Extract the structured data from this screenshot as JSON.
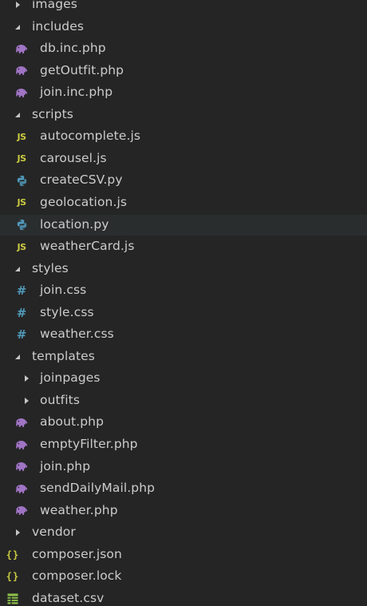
{
  "explorer": {
    "items": [
      {
        "label": "images",
        "kind": "folder",
        "state": "collapsed",
        "depth": 1,
        "icon": "chevron-right-icon"
      },
      {
        "label": "includes",
        "kind": "folder",
        "state": "expanded",
        "depth": 1,
        "icon": "chevron-down-icon"
      },
      {
        "label": "db.inc.php",
        "kind": "file",
        "depth": 2,
        "icon": "php-elephant-icon"
      },
      {
        "label": "getOutfit.php",
        "kind": "file",
        "depth": 2,
        "icon": "php-elephant-icon"
      },
      {
        "label": "join.inc.php",
        "kind": "file",
        "depth": 2,
        "icon": "php-elephant-icon"
      },
      {
        "label": "scripts",
        "kind": "folder",
        "state": "expanded",
        "depth": 1,
        "icon": "chevron-down-icon"
      },
      {
        "label": "autocomplete.js",
        "kind": "file",
        "depth": 2,
        "icon": "javascript-icon",
        "glyph": "JS"
      },
      {
        "label": "carousel.js",
        "kind": "file",
        "depth": 2,
        "icon": "javascript-icon",
        "glyph": "JS"
      },
      {
        "label": "createCSV.py",
        "kind": "file",
        "depth": 2,
        "icon": "python-icon"
      },
      {
        "label": "geolocation.js",
        "kind": "file",
        "depth": 2,
        "icon": "javascript-icon",
        "glyph": "JS"
      },
      {
        "label": "location.py",
        "kind": "file",
        "depth": 2,
        "icon": "python-icon",
        "selected": true
      },
      {
        "label": "weatherCard.js",
        "kind": "file",
        "depth": 2,
        "icon": "javascript-icon",
        "glyph": "JS"
      },
      {
        "label": "styles",
        "kind": "folder",
        "state": "expanded",
        "depth": 1,
        "icon": "chevron-down-icon"
      },
      {
        "label": "join.css",
        "kind": "file",
        "depth": 2,
        "icon": "css-hash-icon",
        "glyph": "#"
      },
      {
        "label": "style.css",
        "kind": "file",
        "depth": 2,
        "icon": "css-hash-icon",
        "glyph": "#"
      },
      {
        "label": "weather.css",
        "kind": "file",
        "depth": 2,
        "icon": "css-hash-icon",
        "glyph": "#"
      },
      {
        "label": "templates",
        "kind": "folder",
        "state": "expanded",
        "depth": 1,
        "icon": "chevron-down-icon"
      },
      {
        "label": "joinpages",
        "kind": "folder",
        "state": "collapsed",
        "depth": 2,
        "icon": "chevron-right-icon"
      },
      {
        "label": "outfits",
        "kind": "folder",
        "state": "collapsed",
        "depth": 2,
        "icon": "chevron-right-icon"
      },
      {
        "label": "about.php",
        "kind": "file",
        "depth": 2,
        "icon": "php-elephant-icon"
      },
      {
        "label": "emptyFilter.php",
        "kind": "file",
        "depth": 2,
        "icon": "php-elephant-icon"
      },
      {
        "label": "join.php",
        "kind": "file",
        "depth": 2,
        "icon": "php-elephant-icon"
      },
      {
        "label": "sendDailyMail.php",
        "kind": "file",
        "depth": 2,
        "icon": "php-elephant-icon"
      },
      {
        "label": "weather.php",
        "kind": "file",
        "depth": 2,
        "icon": "php-elephant-icon"
      },
      {
        "label": "vendor",
        "kind": "folder",
        "state": "collapsed",
        "depth": 1,
        "icon": "chevron-right-icon"
      },
      {
        "label": "composer.json",
        "kind": "file",
        "depth": 1,
        "icon": "json-braces-icon",
        "glyph": "{}"
      },
      {
        "label": "composer.lock",
        "kind": "file",
        "depth": 1,
        "icon": "json-braces-icon",
        "glyph": "{}"
      },
      {
        "label": "dataset.csv",
        "kind": "file",
        "depth": 1,
        "icon": "csv-table-icon"
      }
    ]
  },
  "colors": {
    "background": "#252526",
    "text": "#cccccc",
    "selected_row": "#2a2d2e",
    "php": "#a074c4",
    "javascript": "#cbcb41",
    "python": "#519aba",
    "css": "#519aba",
    "json": "#cbcb41",
    "csv": "#8dc149"
  }
}
